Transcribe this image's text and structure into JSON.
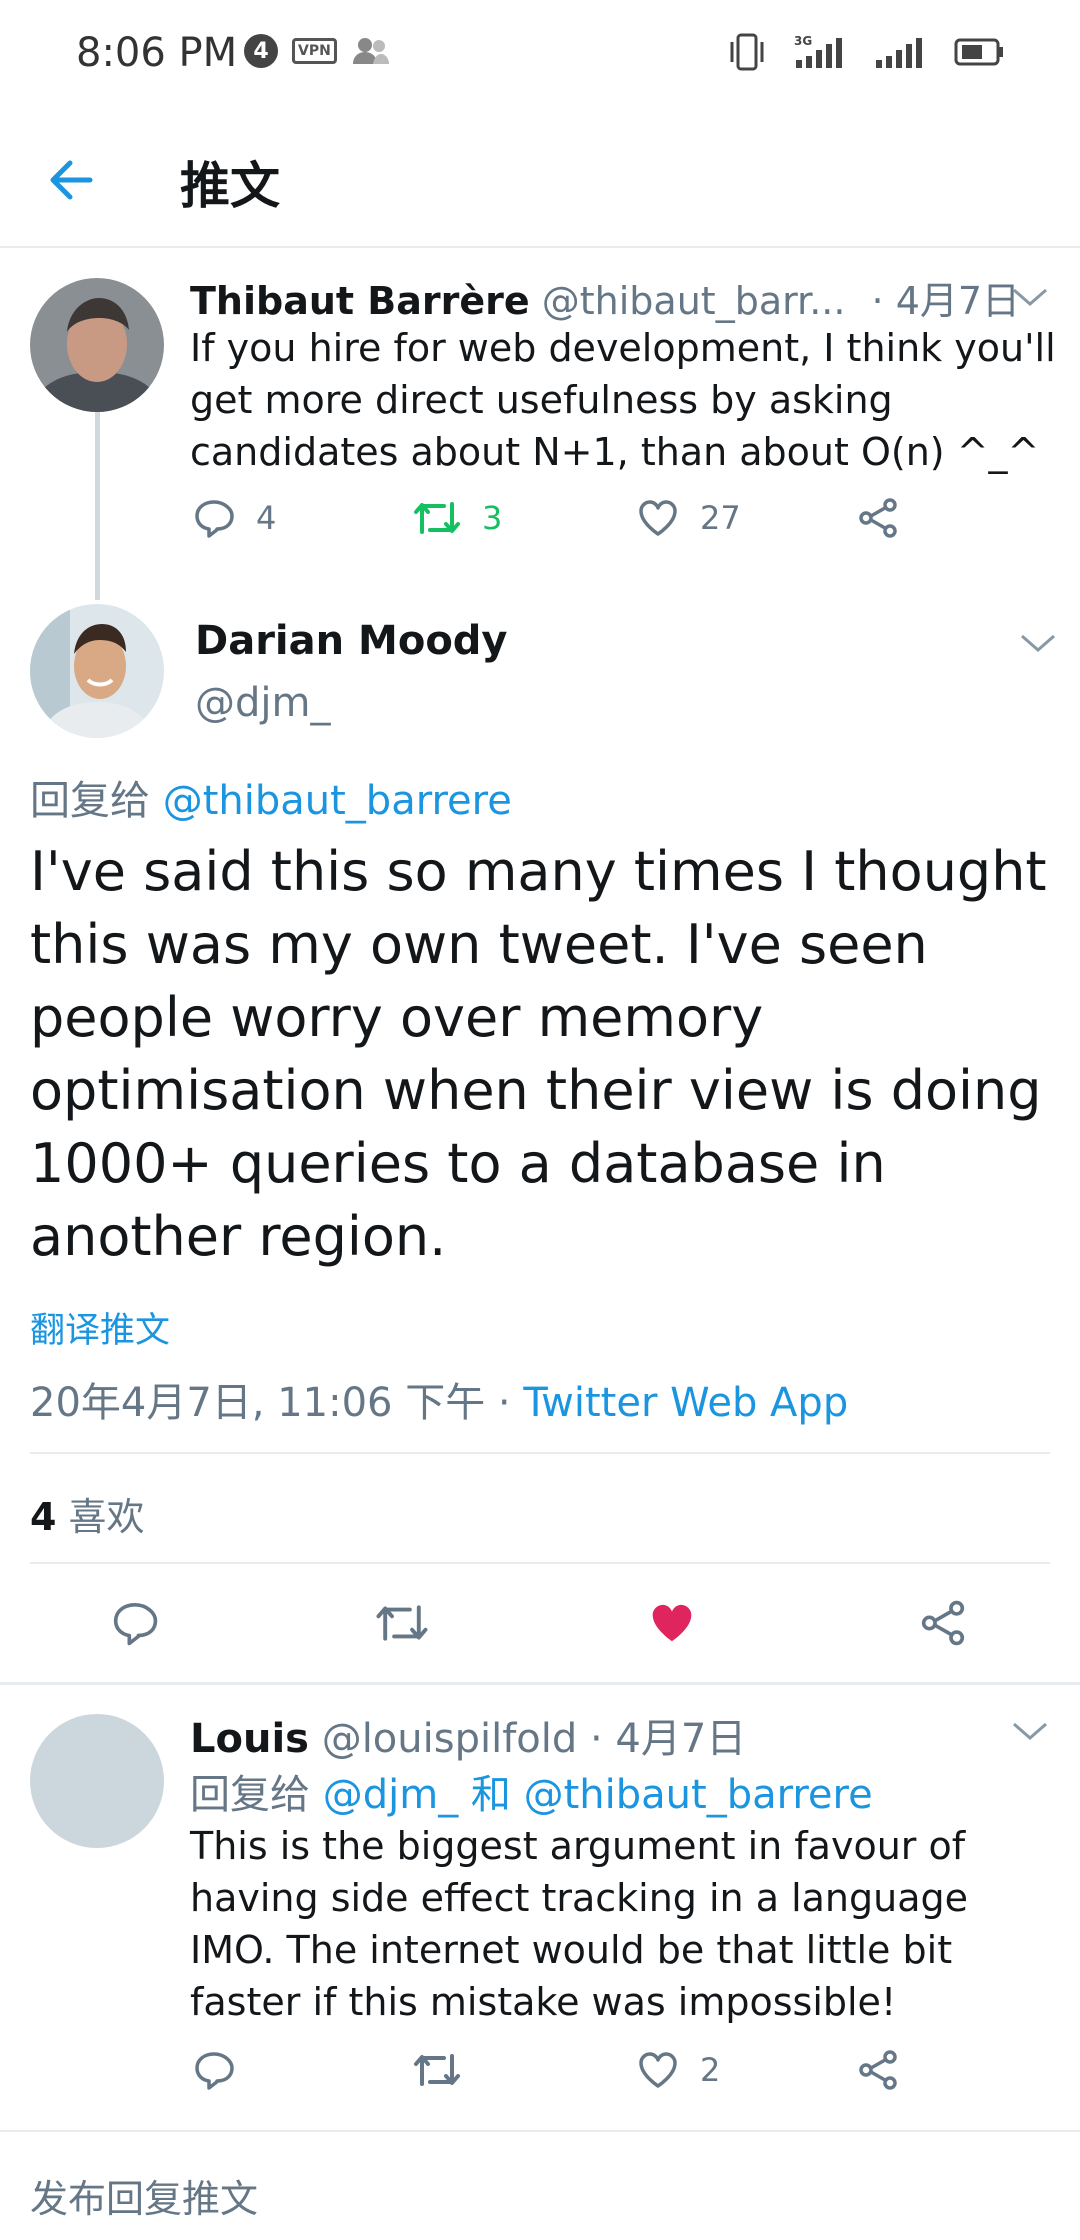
{
  "status_bar": {
    "time": "8:06 PM",
    "notif_count": "4",
    "vpn": "VPN"
  },
  "header": {
    "title": "推文"
  },
  "parent_tweet": {
    "name": "Thibaut Barrère",
    "handle": "@thibaut_barr...",
    "date": "· 4月7日",
    "body": "If you hire for web development, I think you'll get more direct usefulness by asking candidates about N+1, than about O(n) ^_^",
    "replies": "4",
    "retweets": "3",
    "likes": "27"
  },
  "main_tweet": {
    "name": "Darian Moody",
    "handle": "@djm_",
    "reply_prefix": "回复给",
    "reply_to": "@thibaut_barrere",
    "body": "I've said this so many times I thought this was my own tweet. I've seen people worry over memory optimisation when their view is doing 1000+ queries to a database in another region.",
    "translate": "翻译推文",
    "timestamp": "20年4月7日, 11:06 下午 · ",
    "source": "Twitter Web App",
    "likes_count": "4",
    "likes_label": "喜欢"
  },
  "reply_tweet": {
    "name": "Louis",
    "handle": "@louispilfold",
    "date": "· 4月7日",
    "reply_prefix": "回复给",
    "reply_to_1": "@djm_",
    "reply_and": "和",
    "reply_to_2": "@thibaut_barrere",
    "body": "This is the biggest argument in favour of having side effect tracking in a language IMO. The internet would be that little bit faster if this mistake was impossible!",
    "likes": "2"
  },
  "compose": {
    "placeholder": "发布回复推文"
  },
  "colors": {
    "accent": "#1b95e0",
    "retweet": "#17bf63",
    "like": "#e0245e",
    "muted": "#657786"
  }
}
